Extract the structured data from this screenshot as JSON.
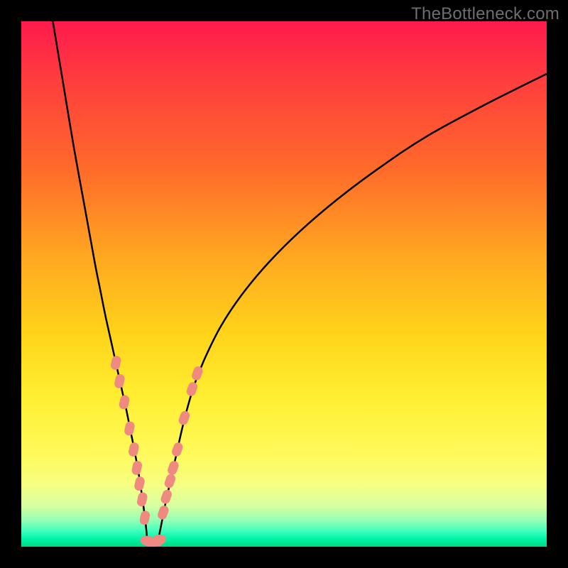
{
  "watermark": "TheBottleneck.com",
  "colors": {
    "curve_stroke": "#000000",
    "marker_fill": "#ef8a80",
    "marker_stroke": "#ef8a80"
  },
  "chart_data": {
    "type": "line",
    "title": "",
    "xlabel": "",
    "ylabel": "",
    "xlim": [
      0,
      100
    ],
    "ylim": [
      0,
      100
    ],
    "grid": false,
    "series": [
      {
        "name": "left-curve",
        "x": [
          6,
          8,
          10,
          12,
          14,
          15,
          16,
          17,
          18,
          19,
          20,
          20.8,
          21.6,
          22.4,
          23,
          23.6,
          24
        ],
        "y": [
          100,
          88,
          76,
          65,
          54,
          49,
          44,
          39.5,
          35,
          30.5,
          26,
          22,
          18,
          13.5,
          9.5,
          5,
          1
        ]
      },
      {
        "name": "right-curve",
        "x": [
          26,
          26.8,
          27.6,
          28.5,
          29.5,
          30.5,
          31.5,
          33,
          35,
          38,
          42,
          47,
          53,
          60,
          68,
          77,
          88,
          100
        ],
        "y": [
          1,
          5,
          9,
          13,
          17.5,
          22,
          26,
          31,
          36,
          42,
          48,
          54,
          60,
          66,
          72,
          78,
          84,
          90
        ]
      },
      {
        "name": "valley-floor",
        "x": [
          24,
          24.6,
          25.2,
          25.6,
          26
        ],
        "y": [
          1,
          0.5,
          0.4,
          0.5,
          1
        ]
      }
    ],
    "markers": {
      "left": [
        {
          "x": 18.0,
          "y": 35.0
        },
        {
          "x": 18.7,
          "y": 31.5
        },
        {
          "x": 19.6,
          "y": 27.5
        },
        {
          "x": 20.6,
          "y": 22.5
        },
        {
          "x": 21.4,
          "y": 18.5
        },
        {
          "x": 22.0,
          "y": 15.0
        },
        {
          "x": 22.5,
          "y": 12.0
        },
        {
          "x": 23.0,
          "y": 9.0
        },
        {
          "x": 23.5,
          "y": 5.5
        }
      ],
      "right": [
        {
          "x": 27.0,
          "y": 6.5
        },
        {
          "x": 27.6,
          "y": 9.5
        },
        {
          "x": 28.3,
          "y": 12.5
        },
        {
          "x": 28.9,
          "y": 15.0
        },
        {
          "x": 29.7,
          "y": 18.5
        },
        {
          "x": 31.0,
          "y": 24.5
        },
        {
          "x": 32.5,
          "y": 30.0
        },
        {
          "x": 33.5,
          "y": 33.0
        }
      ],
      "floor": [
        {
          "x": 23.9,
          "y": 1.2
        },
        {
          "x": 24.6,
          "y": 0.9
        },
        {
          "x": 25.2,
          "y": 0.9
        },
        {
          "x": 25.8,
          "y": 1.0
        },
        {
          "x": 26.3,
          "y": 1.4
        }
      ]
    }
  }
}
